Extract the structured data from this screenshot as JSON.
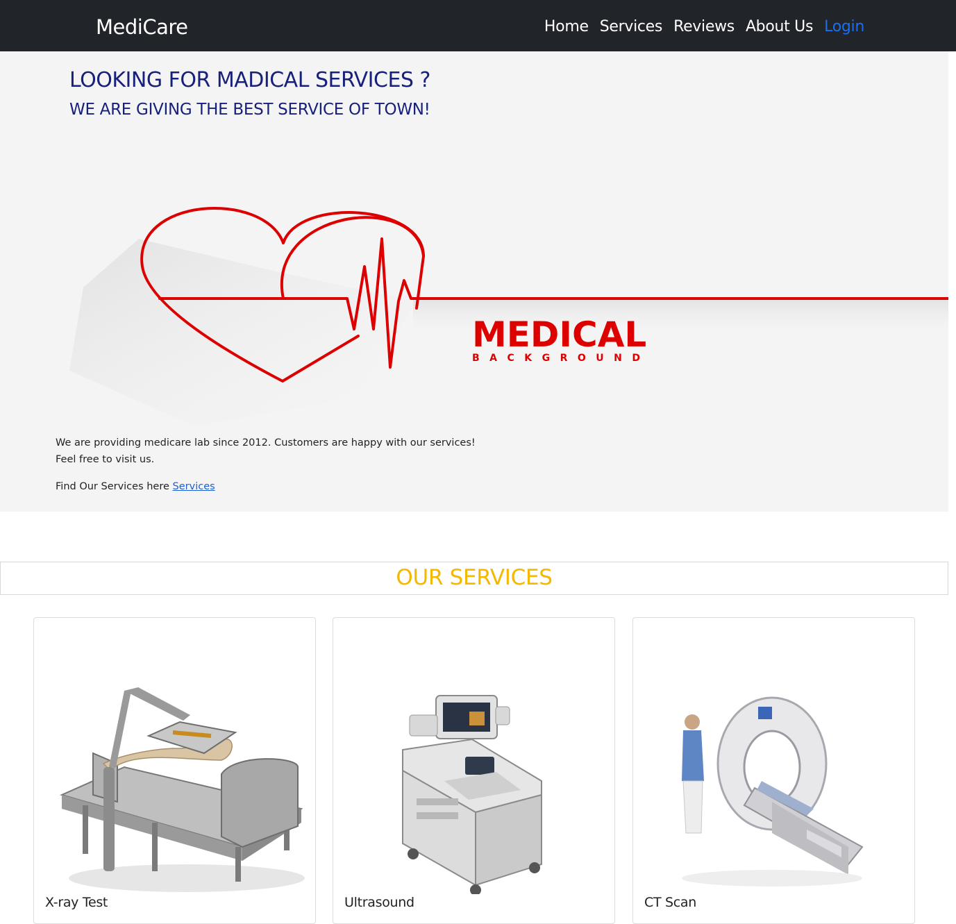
{
  "navbar": {
    "brand": "MediCare",
    "links": [
      "Home",
      "Services",
      "Reviews",
      "About Us"
    ],
    "login": "Login"
  },
  "hero": {
    "heading": "LOOKING FOR MADICAL SERVICES ?",
    "subheading": "WE ARE GIVING THE BEST SERVICE OF TOWN!",
    "graphic_word": "MEDICAL",
    "graphic_subword": "BACKGROUND",
    "text_line1": "We are providing medicare lab since 2012. Customers are happy with our services!",
    "text_line2": "Feel free to visit us.",
    "find_text": "Find Our Services here ",
    "find_link": "Services"
  },
  "services": {
    "title": "OUR SERVICES",
    "cards": [
      {
        "title": "X-ray Test"
      },
      {
        "title": "Ultrasound"
      },
      {
        "title": "CT Scan"
      }
    ]
  }
}
